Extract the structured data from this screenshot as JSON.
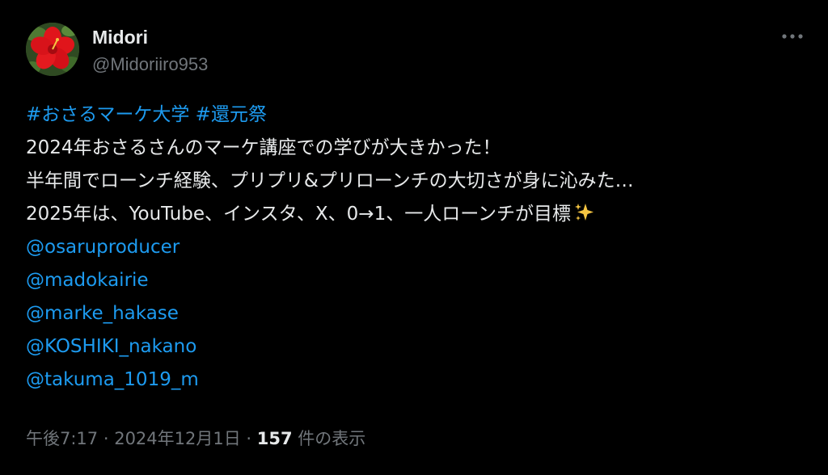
{
  "author": {
    "name": "Midori",
    "handle": "@Midoriiro953"
  },
  "tweet": {
    "hashtags": [
      "#おさるマーケ大学",
      "#還元祭"
    ],
    "lines": [
      "2024年おさるさんのマーケ講座での学びが大きかった！",
      "半年間でローンチ経験、プリプリ&プリローンチの大切さが身に沁みた…",
      "2025年は、YouTube、インスタ、X、0→1、一人ローンチが目標"
    ],
    "sparkle_emoji": "sparkles-icon",
    "mentions": [
      "@osaruproducer",
      "@madokairie",
      "@marke_hakase",
      "@KOSHIKI_nakano",
      "@takuma_1019_m"
    ]
  },
  "meta": {
    "time": "午後7:17",
    "sep1": " · ",
    "date": "2024年12月1日",
    "sep2": " · ",
    "views_count": "157",
    "views_label": " 件の表示"
  },
  "colors": {
    "background": "#000000",
    "text": "#e7e9ea",
    "secondary": "#71767b",
    "link": "#1d9bf0"
  }
}
